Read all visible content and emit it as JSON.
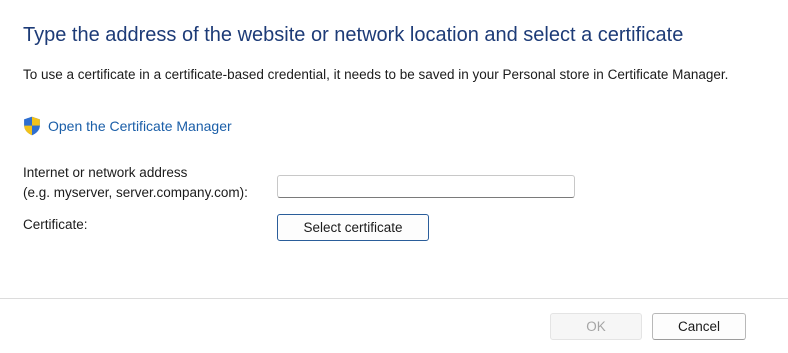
{
  "heading": "Type the address of the website or network location and select a certificate",
  "description": "To use a certificate in a certificate-based credential, it needs to be saved in your Personal store in Certificate Manager.",
  "cert_manager_link": {
    "icon": "uac-shield-icon",
    "label": "Open the Certificate Manager"
  },
  "address": {
    "label_line1": "Internet or network address",
    "label_line2": "(e.g. myserver, server.company.com):",
    "value": "",
    "placeholder": ""
  },
  "certificate": {
    "label": "Certificate:",
    "button_label": "Select certificate"
  },
  "footer": {
    "ok_label": "OK",
    "ok_enabled": false,
    "cancel_label": "Cancel"
  },
  "colors": {
    "heading": "#1d3b77",
    "link": "#1a5ea8",
    "shield_blue": "#2f6fd0",
    "shield_yellow": "#f2c21b"
  }
}
